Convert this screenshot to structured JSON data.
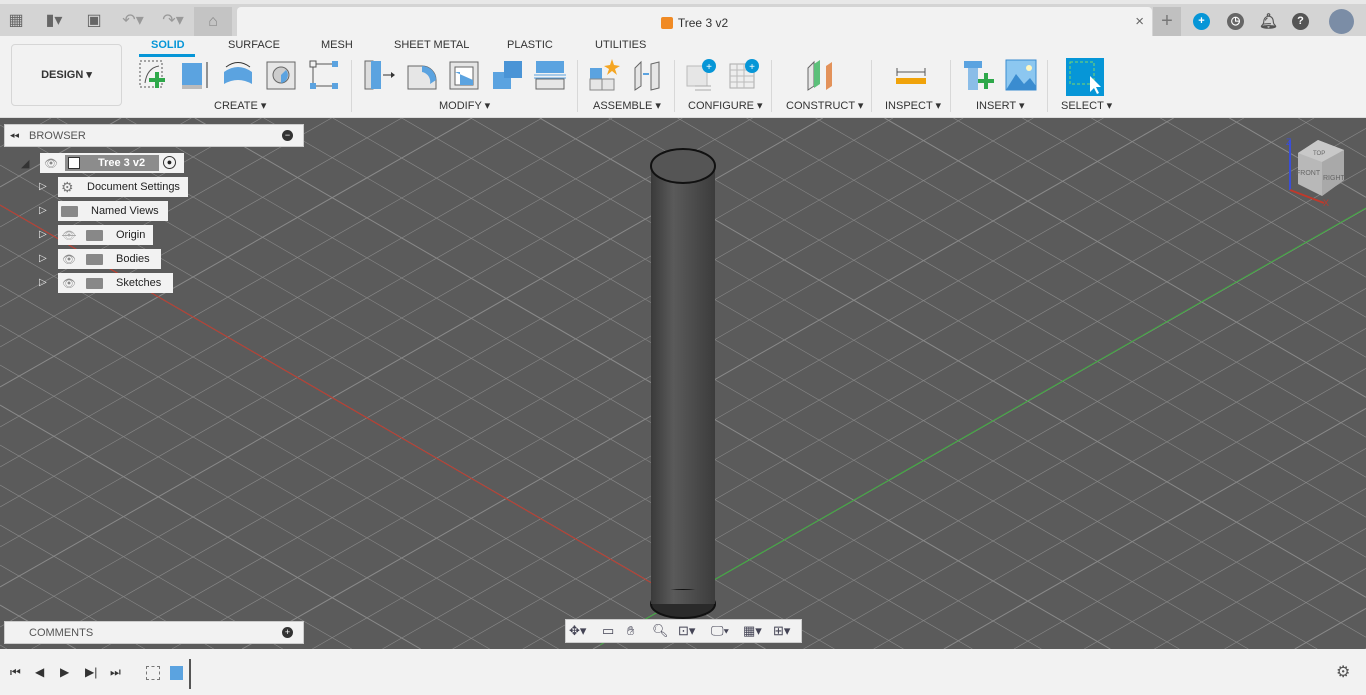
{
  "app": {
    "document_title": "Tree 3 v2",
    "close_tab": "×",
    "new_tab": "+"
  },
  "workspace": {
    "label": "DESIGN ▾"
  },
  "ribbon": {
    "tabs": [
      {
        "label": "SOLID",
        "active": true
      },
      {
        "label": "SURFACE"
      },
      {
        "label": "MESH"
      },
      {
        "label": "SHEET METAL"
      },
      {
        "label": "PLASTIC"
      },
      {
        "label": "UTILITIES"
      }
    ],
    "groups": [
      "CREATE ▾",
      "MODIFY ▾",
      "ASSEMBLE ▾",
      "CONFIGURE ▾",
      "CONSTRUCT ▾",
      "INSPECT ▾",
      "INSERT ▾",
      "SELECT ▾"
    ]
  },
  "browser": {
    "title": "BROWSER",
    "root": "Tree 3 v2",
    "items": [
      {
        "label": "Document Settings",
        "icon": "gear-icon"
      },
      {
        "label": "Named Views",
        "icon": "folder-icon"
      },
      {
        "label": "Origin",
        "icon": "folder-icon",
        "hidden": true
      },
      {
        "label": "Bodies",
        "icon": "folder-icon"
      },
      {
        "label": "Sketches",
        "icon": "folder-icon"
      }
    ]
  },
  "comments": {
    "title": "COMMENTS"
  },
  "viewcube": {
    "top": "TOP",
    "front": "FRONT",
    "right": "RIGHT",
    "z_axis": "Z",
    "x_axis": "X"
  },
  "colors": {
    "accent": "#0696d7",
    "viewport_bg": "#5b5b5b",
    "x_axis": "#c0392b",
    "y_axis": "#3fae3f"
  }
}
